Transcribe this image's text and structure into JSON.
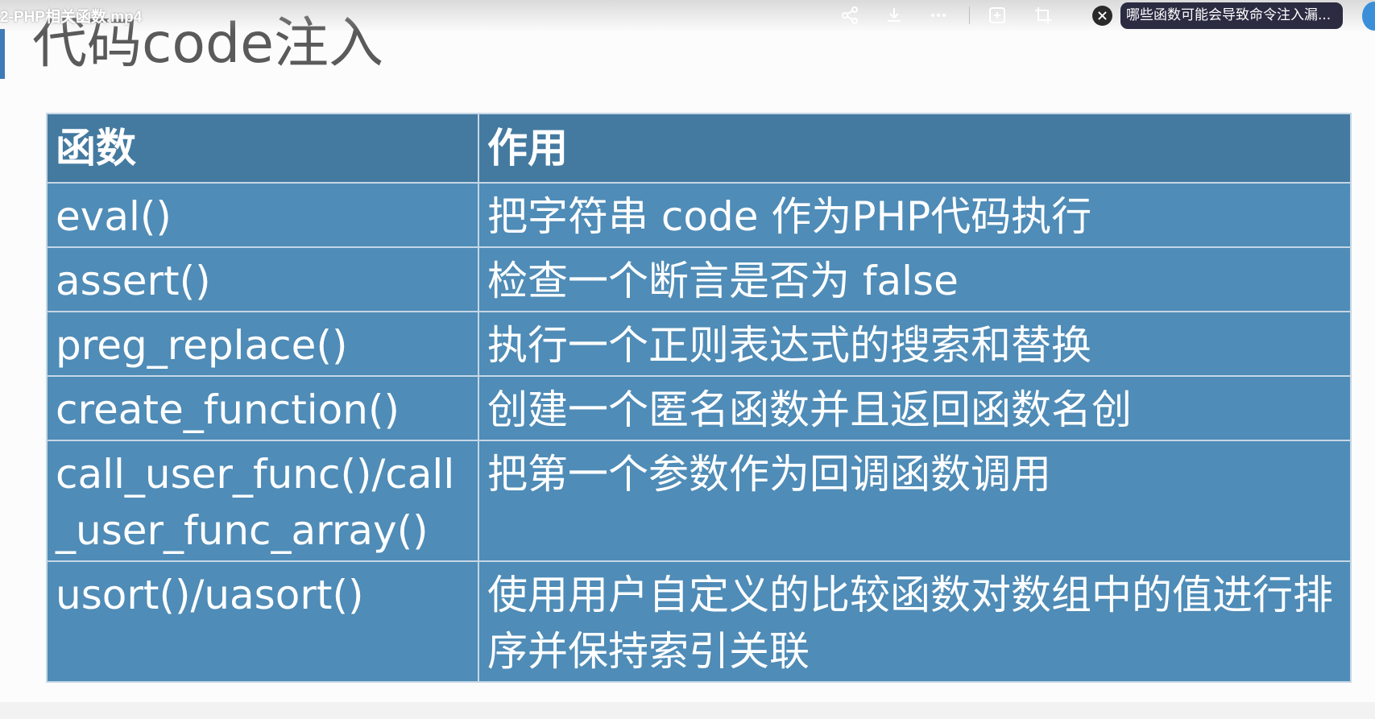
{
  "player": {
    "video_title": "2-PHP相关函数.mp4",
    "toolbar_icons": [
      "share-icon",
      "download-icon",
      "more-icon",
      "screenshot-icon",
      "crop-icon"
    ],
    "question_text": "哪些函数可能会导致命令注入漏..."
  },
  "slide": {
    "title": "代码code注入",
    "table": {
      "headers": [
        "函数",
        "作用"
      ],
      "rows": [
        {
          "func": "eval()",
          "desc": "把字符串 code 作为PHP代码执行"
        },
        {
          "func": "assert()",
          "desc": "检查一个断言是否为 false"
        },
        {
          "func": "preg_replace()",
          "desc": "执行一个正则表达式的搜索和替换"
        },
        {
          "func": "create_function()",
          "desc": "创建一个匿名函数并且返回函数名创"
        },
        {
          "func": "call_user_func()/call_user_func_array()",
          "desc": "把第一个参数作为回调函数调用"
        },
        {
          "func": "usort()/uasort()",
          "desc": "使用用户自定义的比较函数对数组中的值进行排序并保持索引关联"
        }
      ]
    }
  },
  "colors": {
    "header_bg": "#447aa0",
    "cell_bg": "#4f8cb7",
    "grid_line": "#c5d7e6",
    "title_text": "#5a5a5a",
    "accent": "#3d7bb8"
  }
}
